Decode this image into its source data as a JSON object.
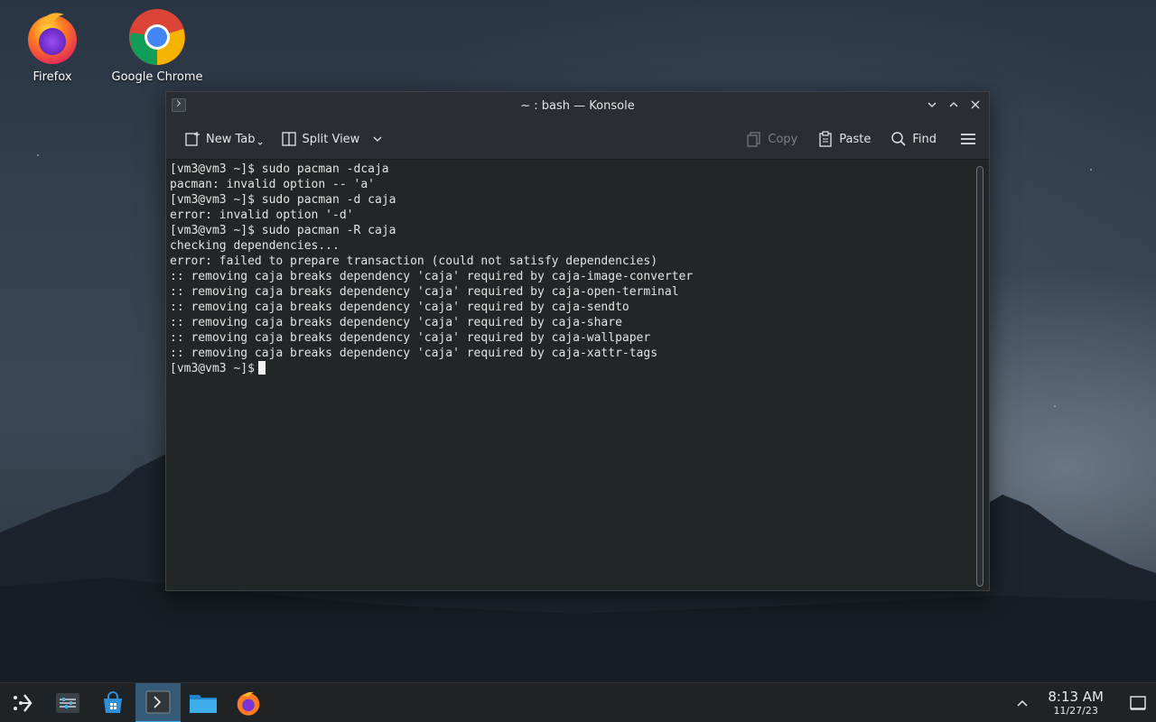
{
  "desktop": {
    "icons": [
      {
        "label": "Firefox"
      },
      {
        "label": "Google Chrome"
      }
    ]
  },
  "window": {
    "title": "~ : bash — Konsole",
    "toolbar": {
      "new_tab": "New Tab",
      "split_view": "Split View",
      "copy": "Copy",
      "paste": "Paste",
      "find": "Find"
    }
  },
  "terminal": {
    "lines": [
      "[vm3@vm3 ~]$ sudo pacman -dcaja",
      "pacman: invalid option -- 'a'",
      "[vm3@vm3 ~]$ sudo pacman -d caja",
      "error: invalid option '-d'",
      "[vm3@vm3 ~]$ sudo pacman -R caja",
      "checking dependencies...",
      "error: failed to prepare transaction (could not satisfy dependencies)",
      ":: removing caja breaks dependency 'caja' required by caja-image-converter",
      ":: removing caja breaks dependency 'caja' required by caja-open-terminal",
      ":: removing caja breaks dependency 'caja' required by caja-sendto",
      ":: removing caja breaks dependency 'caja' required by caja-share",
      ":: removing caja breaks dependency 'caja' required by caja-wallpaper",
      ":: removing caja breaks dependency 'caja' required by caja-xattr-tags"
    ],
    "prompt": "[vm3@vm3 ~]$"
  },
  "taskbar": {
    "clock_time": "8:13 AM",
    "clock_date": "11/27/23",
    "items": [
      "application-launcher-icon",
      "system-settings-icon",
      "discover-store-icon",
      "konsole-icon",
      "dolphin-files-icon",
      "firefox-icon"
    ]
  },
  "colors": {
    "accent": "#3daee9",
    "terminal_bg": "#232627",
    "window_chrome": "#2a2e32",
    "taskbar_bg": "#1f2326"
  }
}
